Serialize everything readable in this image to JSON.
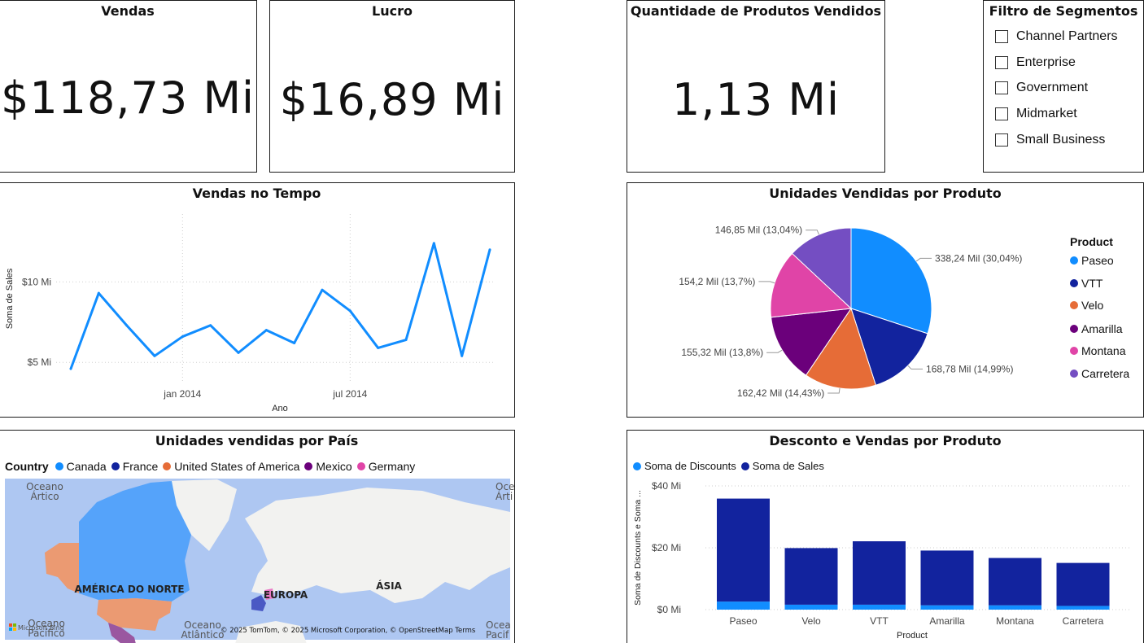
{
  "kpis": {
    "vendas": {
      "title": "Vendas",
      "value": "$118,73 Mi"
    },
    "lucro": {
      "title": "Lucro",
      "value": "$16,89 Mi"
    },
    "quantidade": {
      "title": "Quantidade de Produtos Vendidos",
      "value": "1,13 Mi"
    }
  },
  "segment_filter": {
    "title": "Filtro de Segmentos",
    "items": [
      {
        "label": "Channel Partners",
        "checked": false
      },
      {
        "label": "Enterprise",
        "checked": false
      },
      {
        "label": "Government",
        "checked": false
      },
      {
        "label": "Midmarket",
        "checked": false
      },
      {
        "label": "Small Business",
        "checked": false
      }
    ]
  },
  "line_chart_card": {
    "title": "Vendas no Tempo"
  },
  "pie_card": {
    "title": "Unidades Vendidas por Produto",
    "legend_title": "Product"
  },
  "map_card": {
    "title": "Unidades vendidas por País",
    "legend_title": "Country",
    "legend": [
      {
        "name": "Canada",
        "color": "#118DFF"
      },
      {
        "name": "France",
        "color": "#12239E"
      },
      {
        "name": "United States of America",
        "color": "#E66C37"
      },
      {
        "name": "Mexico",
        "color": "#6B007B"
      },
      {
        "name": "Germany",
        "color": "#E044A7"
      }
    ],
    "labels": {
      "ocean_arctic": "Oceano\nÁrtico",
      "ocean_arctic_right": "Ocea\nÁrti",
      "north_america": "AMÉRICA DO NORTE",
      "europe": "EUROPA",
      "asia": "ÁSIA",
      "ocean_pacific": "Oceano\nPacífico",
      "ocean_atlantic": "Oceano\nAtlântico",
      "ocean_pacific_right": "Ocea\nPacif",
      "microsoft_bing": "Microsoft Bing",
      "attribution": "© 2025 TomTom, © 2025 Microsoft Corporation, © OpenStreetMap  Terms"
    }
  },
  "bar_card": {
    "title": "Desconto e Vendas por Produto"
  },
  "colors": {
    "primary": "#118DFF",
    "dark_blue": "#12239E",
    "orange": "#E66C37",
    "purple": "#6B007B",
    "pink": "#E044A7",
    "violet": "#744EC2"
  },
  "chart_data": [
    {
      "type": "line",
      "title": "Vendas no Tempo",
      "xlabel": "Ano",
      "ylabel": "Soma de Sales",
      "x_ticks": [
        "jan 2014",
        "jul 2014"
      ],
      "y_ticks": [
        "$5 Mi",
        "$10 Mi"
      ],
      "ylim": [
        4.0,
        13.0
      ],
      "x": [
        "2013-09",
        "2013-10",
        "2013-11",
        "2013-12",
        "2014-01",
        "2014-02",
        "2014-03",
        "2014-04",
        "2014-05",
        "2014-06",
        "2014-07",
        "2014-08",
        "2014-09",
        "2014-10",
        "2014-11",
        "2014-12"
      ],
      "series": [
        {
          "values": [
            4.6,
            9.3,
            7.3,
            5.4,
            6.6,
            7.3,
            5.6,
            7.0,
            6.2,
            9.5,
            8.2,
            5.9,
            6.4,
            12.4,
            5.4,
            12.0
          ]
        }
      ],
      "color": "#118DFF",
      "grid": true
    },
    {
      "type": "pie",
      "title": "Unidades Vendidas por Produto",
      "legend_title": "Product",
      "slices": [
        {
          "label": "Paseo",
          "value": 338.24,
          "display": "338,24 Mil (30,04%)",
          "color": "#118DFF"
        },
        {
          "label": "VTT",
          "value": 168.78,
          "display": "168,78 Mil (14,99%)",
          "color": "#12239E"
        },
        {
          "label": "Velo",
          "value": 162.42,
          "display": "162,42 Mil (14,43%)",
          "color": "#E66C37"
        },
        {
          "label": "Amarilla",
          "value": 155.32,
          "display": "155,32 Mil (13,8%)",
          "color": "#6B007B"
        },
        {
          "label": "Montana",
          "value": 154.2,
          "display": "154,2 Mil (13,7%)",
          "color": "#E044A7"
        },
        {
          "label": "Carretera",
          "value": 146.85,
          "display": "146,85 Mil (13,04%)",
          "color": "#744EC2"
        }
      ]
    },
    {
      "type": "bar",
      "title": "Desconto e Vendas por Produto",
      "xlabel": "Product",
      "ylabel": "Soma de Discounts e Soma ...",
      "categories": [
        "Paseo",
        "Velo",
        "VTT",
        "Amarilla",
        "Montana",
        "Carretera"
      ],
      "series": [
        {
          "name": "Soma de Discounts",
          "values": [
            2.6,
            1.6,
            1.6,
            1.4,
            1.4,
            1.2
          ],
          "color": "#118DFF"
        },
        {
          "name": "Soma de  Sales",
          "values": [
            33.3,
            18.3,
            20.5,
            17.7,
            15.3,
            13.9
          ],
          "color": "#12239E"
        }
      ],
      "y_ticks": [
        "$0 Mi",
        "$20 Mi",
        "$40 Mi"
      ],
      "ylim": [
        0,
        40
      ],
      "stacked": true,
      "grid": true
    }
  ]
}
